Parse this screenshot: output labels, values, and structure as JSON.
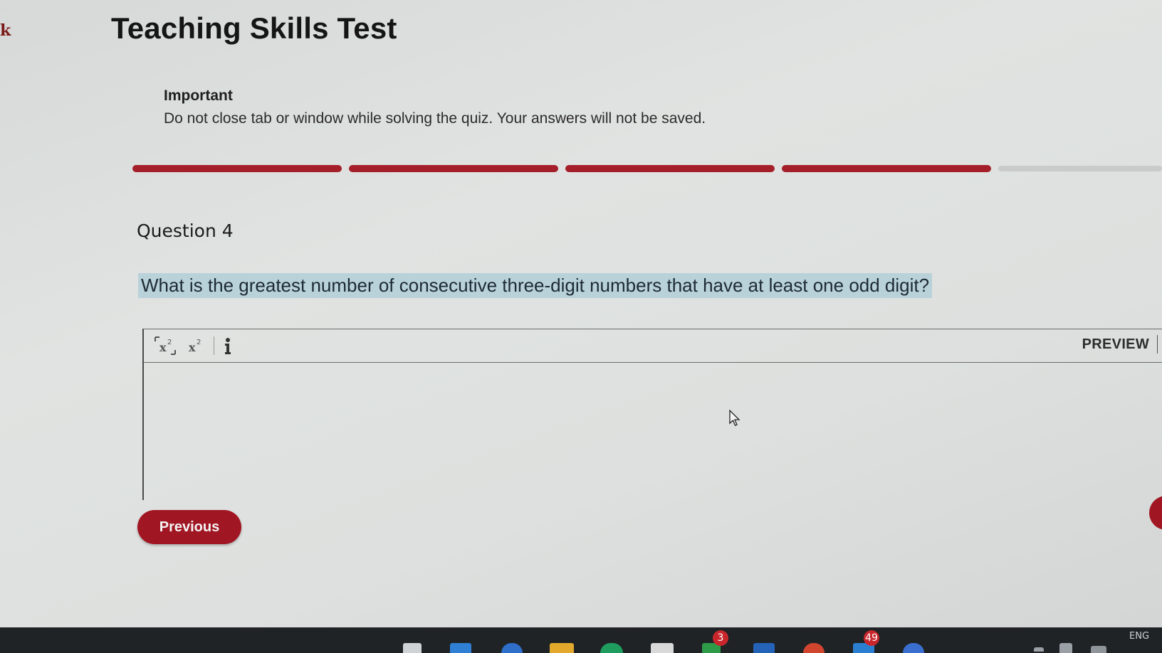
{
  "back_link_fragment": "k",
  "page": {
    "title": "Teaching Skills Test"
  },
  "notice": {
    "title": "Important",
    "text": "Do not close tab or window while solving the quiz. Your answers will not be saved."
  },
  "progress": {
    "total_segments": 5,
    "completed_segments": 4,
    "completed_color": "#a51f2a",
    "pending_color": "#c9cbca"
  },
  "question": {
    "label": "Question 4",
    "text": "What is the greatest number of consecutive three-digit numbers that have at least one odd digit?"
  },
  "editor": {
    "toolbar": [
      {
        "name": "subscript-icon"
      },
      {
        "name": "superscript-icon"
      },
      {
        "name": "info-icon"
      }
    ],
    "preview_label": "PREVIEW",
    "answer_value": ""
  },
  "navigation": {
    "previous_label": "Previous"
  },
  "taskbar": {
    "badges": [
      "3",
      "49"
    ],
    "language": "ENG"
  },
  "colors": {
    "accent": "#a11623",
    "question_highlight": "#b9d2da",
    "taskbar": "#1f2326"
  }
}
